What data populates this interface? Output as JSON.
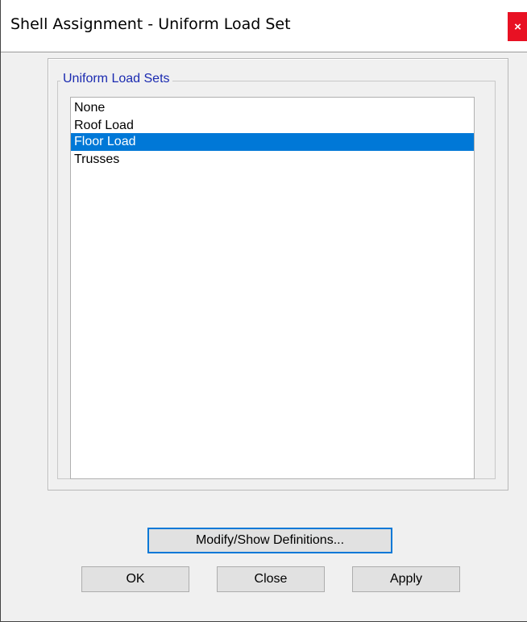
{
  "window": {
    "title": "Shell Assignment - Uniform Load Set",
    "close_glyph": "×"
  },
  "groupbox": {
    "label": "Uniform Load Sets"
  },
  "list": {
    "items": [
      {
        "label": "None"
      },
      {
        "label": "Roof Load"
      },
      {
        "label": "Floor Load"
      },
      {
        "label": "Trusses"
      }
    ],
    "selected": "Floor Load"
  },
  "buttons": {
    "modify": "Modify/Show Definitions...",
    "ok": "OK",
    "close": "Close",
    "apply": "Apply"
  },
  "colors": {
    "selection": "#0078d7",
    "close_button": "#e81123",
    "group_label": "#1a2ab0"
  }
}
